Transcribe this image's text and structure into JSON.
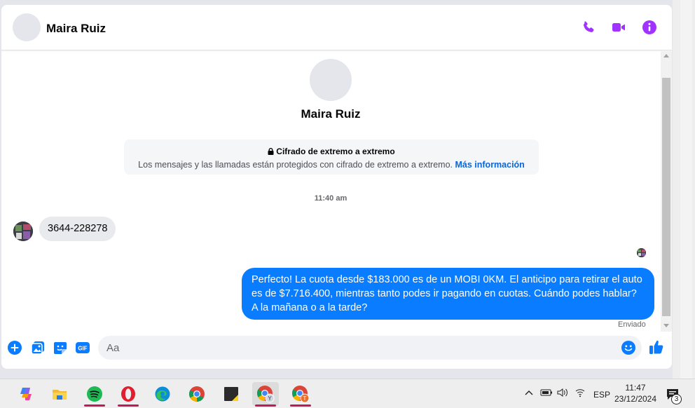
{
  "header": {
    "contact_name": "Maira Ruiz",
    "accent_color": "#a033ff",
    "icons": [
      "phone-icon",
      "video-call-icon",
      "info-icon"
    ]
  },
  "profile": {
    "name": "Maira Ruiz"
  },
  "encryption": {
    "title": "Cifrado de extremo a extremo",
    "description": "Los mensajes y las llamadas están protegidos con cifrado de extremo a extremo.",
    "link": "Más información"
  },
  "timestamp": "11:40 am",
  "messages": {
    "incoming": "3644-228278",
    "outgoing": "Perfecto! La cuota desde $183.000 es de un MOBI 0KM. El anticipo para retirar el auto es de $7.716.400, mientras tanto podes ir pagando en cuotas. Cuándo podes hablar? A la mañana o a la tarde?",
    "status": "Enviado",
    "outgoing_color": "#0a7cff"
  },
  "composer": {
    "placeholder": "Aa",
    "icons": [
      "plus-icon",
      "photo-icon",
      "sticker-icon",
      "gif-icon",
      "emoji-icon",
      "like-icon"
    ],
    "gif_label": "GIF",
    "accent_color": "#0a7cff"
  },
  "taskbar": {
    "apps": [
      "copilot-icon",
      "file-explorer-icon",
      "spotify-icon",
      "opera-icon",
      "edge-icon",
      "chrome-icon",
      "sticky-notes-icon",
      "chrome-profile-y-icon",
      "chrome-profile-t-icon"
    ],
    "language": "ESP",
    "time": "11:47",
    "date": "23/12/2024",
    "notifications": "3"
  }
}
